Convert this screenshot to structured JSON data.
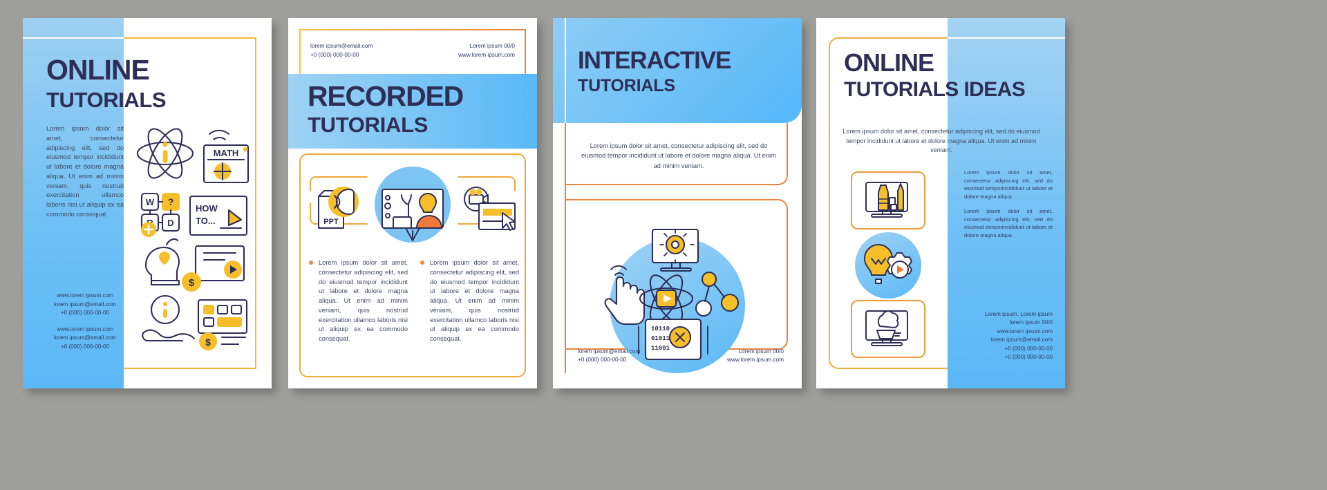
{
  "document": {
    "kind": "brochure-template-preview",
    "panel_count": 4
  },
  "panels": [
    {
      "id": "panel-1",
      "title_line1": "ONLINE",
      "title_line2": "TUTORIALS",
      "blurb": "Lorem ipsum dolor sit amet, consectetur adipiscing elit, sed do eiusmod tempor incididunt ut labore et dolore magna aliqua. Ut enim ad minim veniam, quis nostrud exercitation ullamco laboris nisi ut aliquip ex ea commodo consequat.",
      "contact_a": {
        "website": "www.lorem ipsum.com",
        "email": "lorem ipsum@email.com",
        "phone": "+0 (000) 000-00-00"
      },
      "contact_b": {
        "website": "www.lorem ipsum.com",
        "email": "lorem ipsum@email.com",
        "phone": "+0 (000) 000-00-00"
      },
      "icons": [
        "atom-info-icon",
        "math-board-icon",
        "word-quiz-icon",
        "how-to-icon",
        "mind-heart-icon",
        "video-play-money-icon",
        "info-hand-icon",
        "dollar-keyboard-icon"
      ]
    },
    {
      "id": "panel-2",
      "header_left": {
        "email": "lorem ipsum@email.com",
        "phone": "+0 (000) 000-00-00"
      },
      "header_right": {
        "ref": "Lorem ipsum 00/0",
        "website": "www.lorem ipsum.com"
      },
      "title_line1": "RECORDED",
      "title_line2": "TUTORIALS",
      "columns": [
        "Lorem ipsum dolor sit amet, consectetur adipiscing elit, sed do eiusmod tempor incididunt ut labore et dolore magna aliqua. Ut enim ad minim veniam, quis nostrud exercitation ullamco laboris nisi ut aliquip ex ea commodo consequat.",
        "Lorem ipsum dolor sit amet, consectetur adipiscing elit, sed do eiusmod tempor incididunt ut labore et dolore magna aliqua. Ut enim ad minim veniam, quis nostrud exercitation ullamco laboris nisi ut aliquip ex ea commodo consequat."
      ],
      "icons": [
        "ppt-voice-icon",
        "video-lesson-icon",
        "screencast-cursor-icon"
      ]
    },
    {
      "id": "panel-3",
      "title_line1": "INTERACTIVE",
      "title_line2": "TUTORIALS",
      "description": "Lorem ipsum dolor sit amet, consectetur adipiscing elit, sed do eiusmod tempor incididunt ut labore et dolore magna aliqua. Ut enim ad minim veniam.",
      "footer_left": {
        "email": "lorem ipsum@email.com",
        "phone": "+0 (000) 000-00-00"
      },
      "footer_right": {
        "ref": "Lorem ipsum 00/0",
        "website": "www.lorem ipsum.com"
      },
      "icons": [
        "tap-hand-icon",
        "settings-monitor-icon",
        "atom-play-icon",
        "network-nodes-icon",
        "binary-code-icon"
      ]
    },
    {
      "id": "panel-4",
      "title_line1": "ONLINE",
      "title_line2": "TUTORIALS IDEAS",
      "description": "Lorem ipsum dolor sit amet, consectetur adipiscing elit, sed do eiusmod tempor incididunt ut labore et dolore magna aliqua. Ut enim ad minim veniam.",
      "side_paragraphs": [
        "Lorem ipsum dolor sit amet, consectetur adipiscing elit, sed do eiusmod temporincididunt ut labore et dolore magna aliqua.",
        "Lorem ipsum dolor sit amet, consectetur adipiscing elit, sed do eiusmod temporincididunt ut labore et dolore magna aliqua."
      ],
      "footer": {
        "line1": "Lorem ipsum, Lorem ipsum",
        "line2": "lorem ipsum 00/0",
        "line3": "www.lorem ipsum.com",
        "line4": "lorem ipsum@email.com",
        "line5": "+0 (000) 000-00-00",
        "line6": "+0 (000) 000-00-00"
      },
      "icons": [
        "art-supplies-monitor-icon",
        "lightbulb-gear-play-icon",
        "cooking-monitor-icon"
      ]
    }
  ],
  "colors": {
    "navy": "#2e2e56",
    "blue_light": "#9ed2f4",
    "blue_mid": "#5cb9f7",
    "yellow": "#f3b739",
    "orange": "#e8833b",
    "body_text": "#3f4a63",
    "page_bg": "#9e9e9b"
  }
}
